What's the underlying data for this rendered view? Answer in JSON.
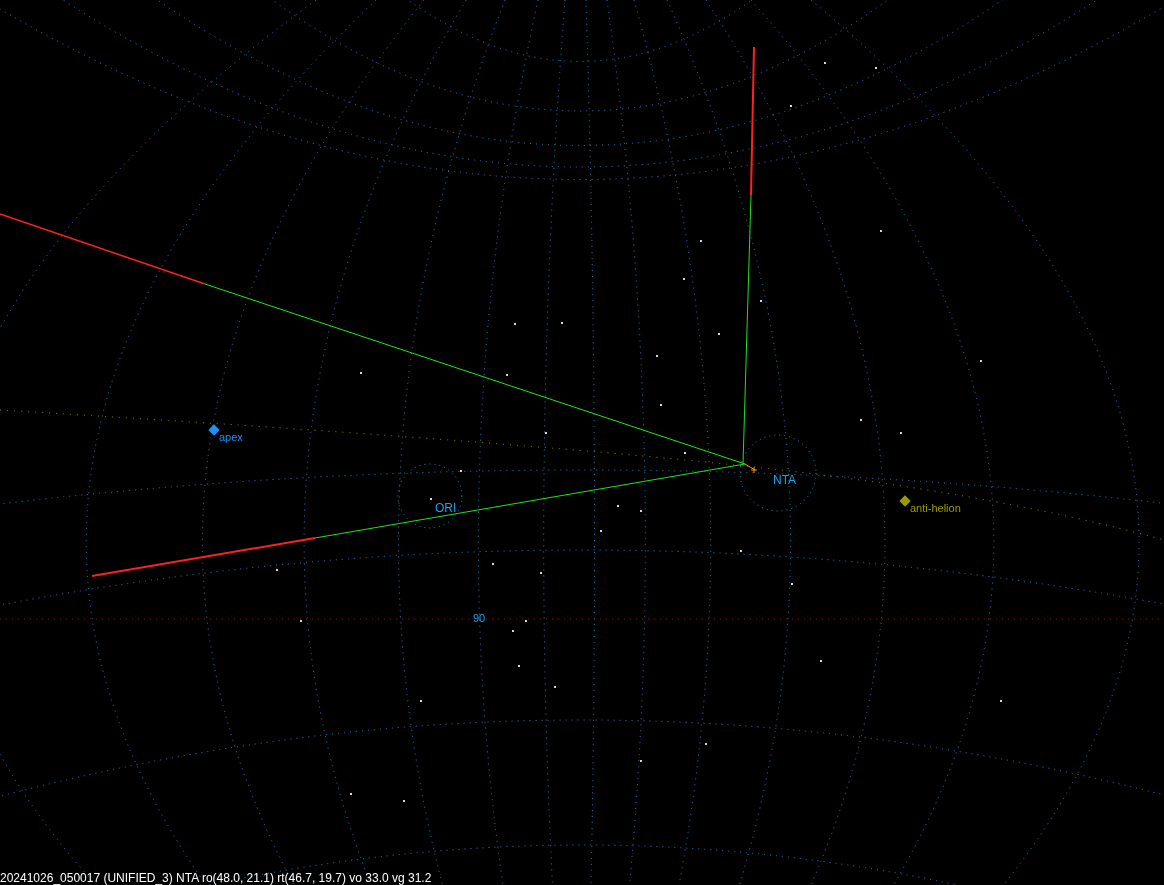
{
  "sky_points": [
    {
      "label": "apex",
      "color": "#1e90ff"
    },
    {
      "label": "anti-helion",
      "color": "#9a9a00"
    }
  ],
  "radiants": [
    {
      "label": "ORI"
    },
    {
      "label": "NTA"
    }
  ],
  "horizon_label": "90",
  "status_bar": "20241026_050017 (UNIFIED_3) NTA ro(48.0, 21.1) rt(46.7, 19.7) vo 33.0 vg 31.2"
}
